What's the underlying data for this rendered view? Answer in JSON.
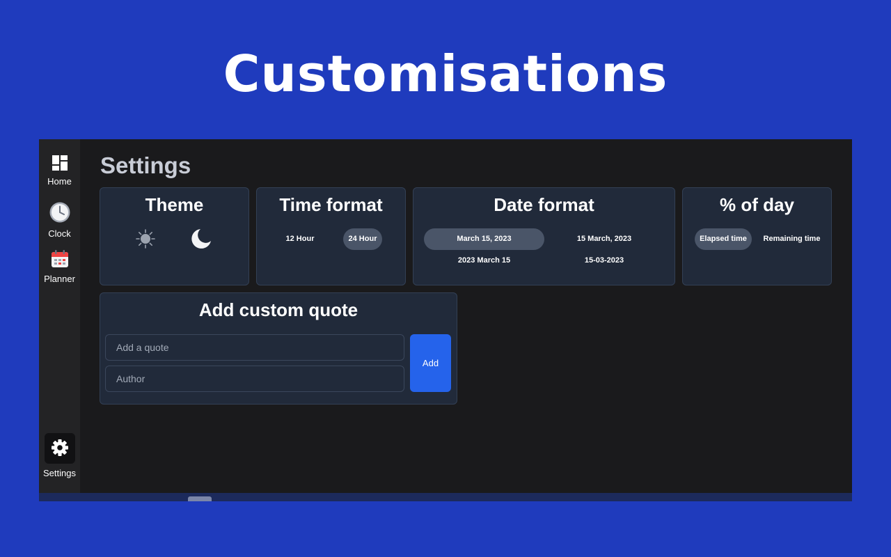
{
  "banner": {
    "title": "Customisations"
  },
  "sidebar": {
    "items": [
      {
        "label": "Home",
        "icon": "dashboard-icon"
      },
      {
        "label": "Clock",
        "icon": "clock-icon"
      },
      {
        "label": "Planner",
        "icon": "calendar-icon"
      },
      {
        "label": "Settings",
        "icon": "gear-icon",
        "active": true
      }
    ]
  },
  "page": {
    "title": "Settings"
  },
  "theme": {
    "title": "Theme",
    "options": [
      "sun-icon",
      "moon-icon"
    ]
  },
  "time_format": {
    "title": "Time format",
    "options": [
      "12 Hour",
      "24 Hour"
    ],
    "selected": "24 Hour"
  },
  "date_format": {
    "title": "Date format",
    "options": [
      "March 15, 2023",
      "15 March, 2023",
      "2023 March 15",
      "15-03-2023"
    ],
    "selected": "March 15, 2023"
  },
  "percent_of_day": {
    "title": "% of day",
    "options": [
      "Elapsed time",
      "Remaining time"
    ],
    "selected": "Elapsed time"
  },
  "quote": {
    "title": "Add custom quote",
    "quote_placeholder": "Add a quote",
    "author_placeholder": "Author",
    "quote_value": "",
    "author_value": "",
    "add_label": "Add"
  },
  "colors": {
    "banner_bg": "#1f3bbd",
    "app_bg": "#1a1a1c",
    "card_bg": "#212a3a",
    "selected_pill": "#4a5568",
    "accent_button": "#2563eb"
  }
}
